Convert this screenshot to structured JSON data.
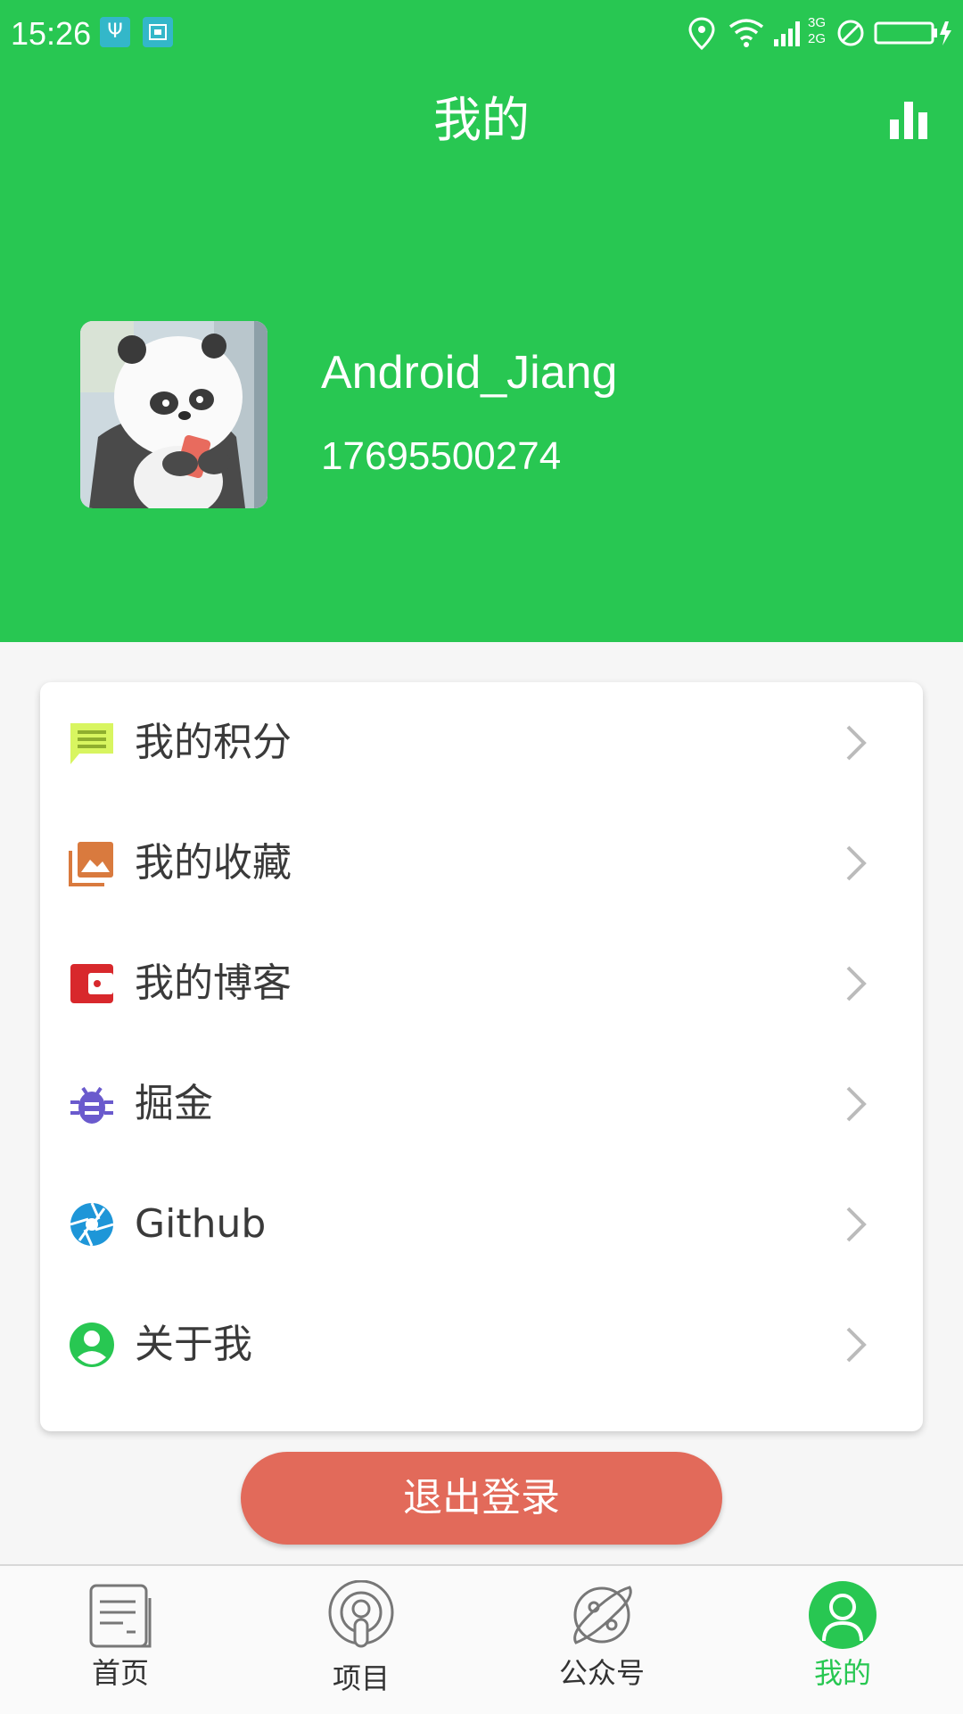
{
  "status_bar": {
    "time": "15:26",
    "network_type_top": "3G",
    "network_type_bottom": "2G"
  },
  "header": {
    "title": "我的",
    "stats_icon": "bar-chart-icon"
  },
  "profile": {
    "username": "Android_Jiang",
    "phone": "17695500274",
    "avatar": "panda-avatar"
  },
  "menu": {
    "items": [
      {
        "label": "我的积分",
        "icon": "chat-icon",
        "color": "#d8f560"
      },
      {
        "label": "我的收藏",
        "icon": "photo-library-icon",
        "color": "#d97a3e"
      },
      {
        "label": "我的博客",
        "icon": "wallet-icon",
        "color": "#d8282c"
      },
      {
        "label": "掘金",
        "icon": "bug-icon",
        "color": "#6a5acd"
      },
      {
        "label": "Github",
        "icon": "aperture-icon",
        "color": "#1e96d8"
      },
      {
        "label": "关于我",
        "icon": "person-icon",
        "color": "#28c752"
      }
    ]
  },
  "logout": {
    "label": "退出登录",
    "color": "#e26a5a"
  },
  "bottom_nav": {
    "items": [
      {
        "label": "首页",
        "icon": "document-icon"
      },
      {
        "label": "项目",
        "icon": "podcast-icon"
      },
      {
        "label": "公众号",
        "icon": "planet-icon"
      },
      {
        "label": "我的",
        "icon": "person-icon"
      }
    ],
    "active_index": 3
  },
  "colors": {
    "primary": "#28c752",
    "background": "#f6f6f6"
  }
}
